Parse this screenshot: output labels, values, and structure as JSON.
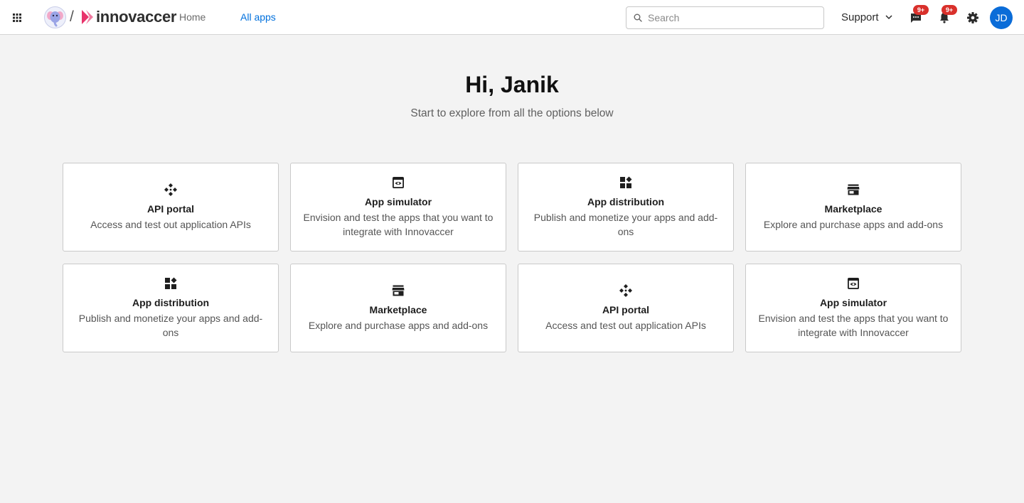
{
  "header": {
    "brand_name": "innovaccer",
    "separator": "/",
    "nav": [
      {
        "label": "Home",
        "active": false
      },
      {
        "label": "All apps",
        "active": true
      }
    ],
    "search_placeholder": "Search",
    "support_label": "Support",
    "chat_badge": "9+",
    "notification_badge": "9+",
    "avatar_initials": "JD",
    "accent_color": "#0070dd",
    "badge_color": "#d9302b",
    "avatar_color": "#0a6cd8"
  },
  "hero": {
    "greeting": "Hi, Janik",
    "subtitle": "Start to explore from all the options below"
  },
  "cards": [
    {
      "icon": "api-portal-icon",
      "title": "API portal",
      "description": "Access and test out application APIs"
    },
    {
      "icon": "app-simulator-icon",
      "title": "App simulator",
      "description": "Envision and test the apps that you want to integrate with Innovaccer"
    },
    {
      "icon": "app-distribution-icon",
      "title": "App distribution",
      "description": "Publish and monetize your apps and add-ons"
    },
    {
      "icon": "marketplace-icon",
      "title": "Marketplace",
      "description": "Explore and purchase apps and add-ons"
    },
    {
      "icon": "app-distribution-icon",
      "title": "App distribution",
      "description": "Publish and monetize your apps and add-ons"
    },
    {
      "icon": "marketplace-icon",
      "title": "Marketplace",
      "description": "Explore and purchase apps and add-ons"
    },
    {
      "icon": "api-portal-icon",
      "title": "API portal",
      "description": "Access and test out application APIs"
    },
    {
      "icon": "app-simulator-icon",
      "title": "App simulator",
      "description": "Envision and test the apps that you want to integrate with Innovaccer"
    }
  ]
}
